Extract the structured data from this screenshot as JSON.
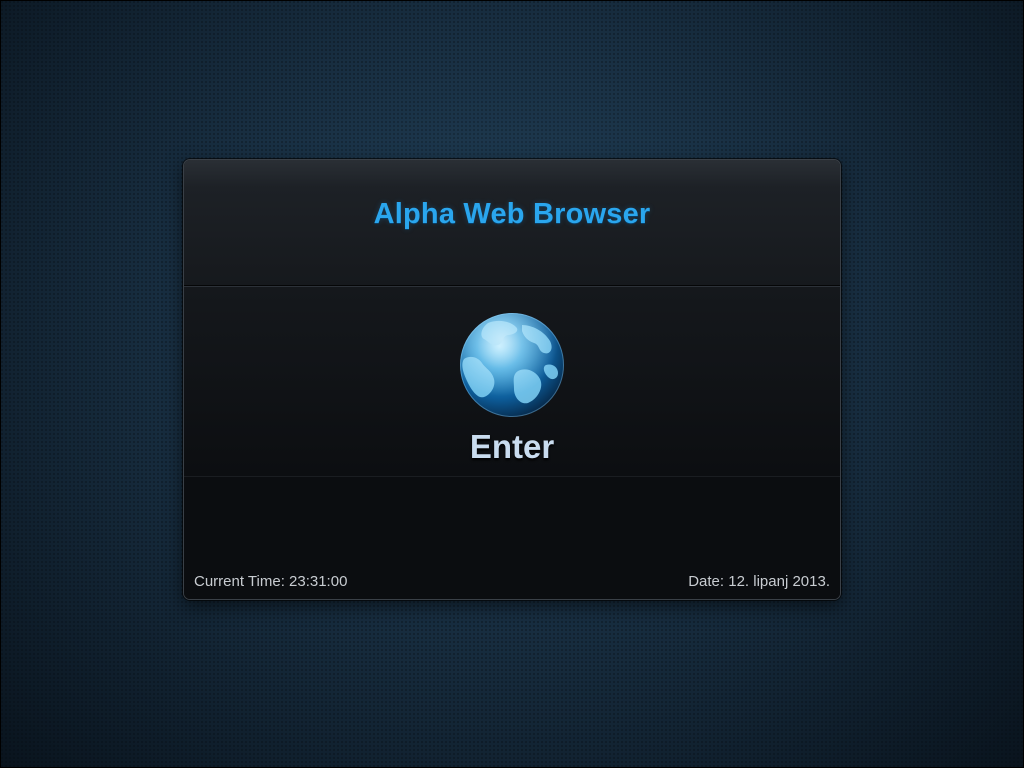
{
  "app": {
    "title": "Alpha Web Browser"
  },
  "enter": {
    "label": "Enter",
    "icon": "globe-icon"
  },
  "footer": {
    "time": "Current Time: 23:31:00",
    "date": "Date: 12. lipanj 2013."
  },
  "colors": {
    "title": "#2aa6ee",
    "enter_label": "#c9dcef",
    "footer_text": "#c8ccd1",
    "panel_bg": "#0d1014",
    "page_bg": "#1b3347"
  }
}
